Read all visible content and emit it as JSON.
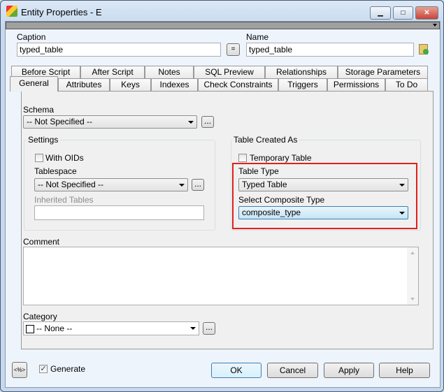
{
  "window": {
    "title": "Entity Properties - E",
    "minimize": "▁",
    "maximize": "□",
    "close": "✕"
  },
  "caption": {
    "label": "Caption",
    "value": "typed_table"
  },
  "equals_button": "=",
  "name": {
    "label": "Name",
    "value": "typed_table"
  },
  "tabs_top": [
    "Before Script",
    "After Script",
    "Notes",
    "SQL Preview",
    "Relationships",
    "Storage Parameters"
  ],
  "tabs_bottom": [
    "General",
    "Attributes",
    "Keys",
    "Indexes",
    "Check Constraints",
    "Triggers",
    "Permissions",
    "To Do"
  ],
  "general": {
    "schema_label": "Schema",
    "schema_value": "-- Not Specified --",
    "ellipsis": "...",
    "settings_label": "Settings",
    "with_oids": "With OIDs",
    "tablespace_label": "Tablespace",
    "tablespace_value": "-- Not Specified --",
    "inherited_label": "Inherited Tables",
    "created_as_label": "Table Created As",
    "temporary": "Temporary Table",
    "table_type_label": "Table Type",
    "table_type_value": "Typed Table",
    "composite_label": "Select Composite Type",
    "composite_value": "composite_type",
    "comment_label": "Comment",
    "comment_value": "",
    "category_label": "Category",
    "category_value": "-- None --"
  },
  "footer": {
    "macro": "<%>",
    "generate": "Generate",
    "ok": "OK",
    "cancel": "Cancel",
    "apply": "Apply",
    "help": "Help"
  },
  "colors": {
    "highlight": "#e0201c",
    "focus": "#3c7fb1"
  }
}
